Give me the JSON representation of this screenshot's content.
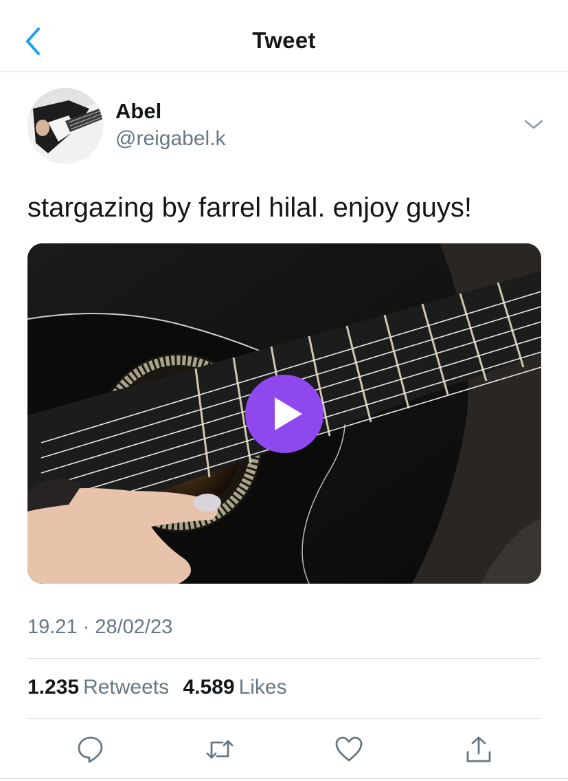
{
  "header": {
    "title": "Tweet",
    "back_icon": "chevron-left-icon",
    "accent": "#1da1f2"
  },
  "tweet": {
    "author_name": "Abel",
    "author_handle": "@reigabel.k",
    "text": "stargazing by farrel hilal. enjoy guys!",
    "media": {
      "kind": "video",
      "play_color": "#8f47ee"
    },
    "timestamp": "19.21 · 28/02/23",
    "retweets_count": "1.235",
    "retweets_label": "Retweets",
    "likes_count": "4.589",
    "likes_label": "Likes"
  },
  "actions": [
    {
      "name": "reply",
      "icon": "comment-icon"
    },
    {
      "name": "retweet",
      "icon": "retweet-icon"
    },
    {
      "name": "like",
      "icon": "heart-icon"
    },
    {
      "name": "share",
      "icon": "share-icon"
    }
  ]
}
